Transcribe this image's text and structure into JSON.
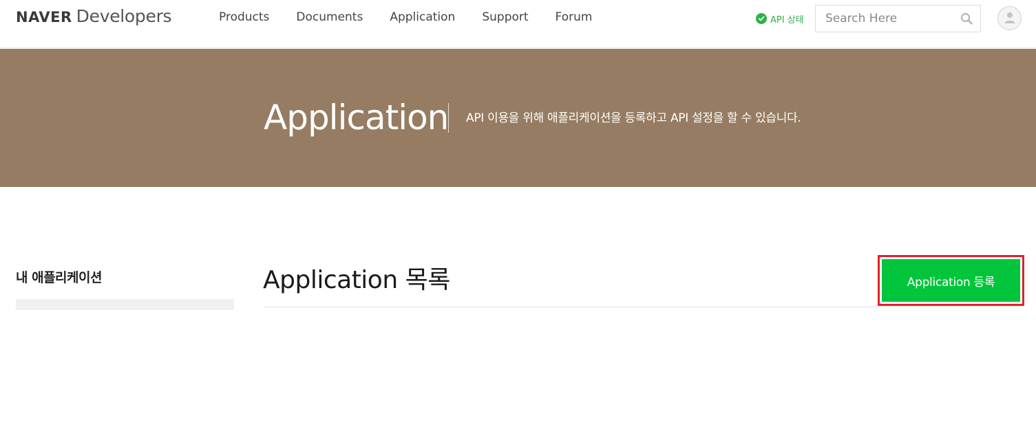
{
  "header": {
    "logo_brand": "NAVER",
    "logo_suffix": "Developers",
    "nav": [
      "Products",
      "Documents",
      "Application",
      "Support",
      "Forum"
    ],
    "api_status_label": "API 상태",
    "search_placeholder": "Search Here",
    "icons": {
      "api_status": "check-circle-icon",
      "search": "search-icon",
      "avatar": "user-icon"
    }
  },
  "banner": {
    "title": "Application",
    "description": "API 이용을 위해 애플리케이션을 등록하고 API 설정을 할 수 있습니다."
  },
  "sidebar": {
    "title": "내 애플리케이션"
  },
  "main": {
    "title": "Application 목록",
    "register_button_label": "Application 등록"
  },
  "colors": {
    "banner_bg": "#967c62",
    "accent_green": "#03c53b",
    "status_green": "#2fb14a",
    "highlight_red": "#e0202a"
  }
}
